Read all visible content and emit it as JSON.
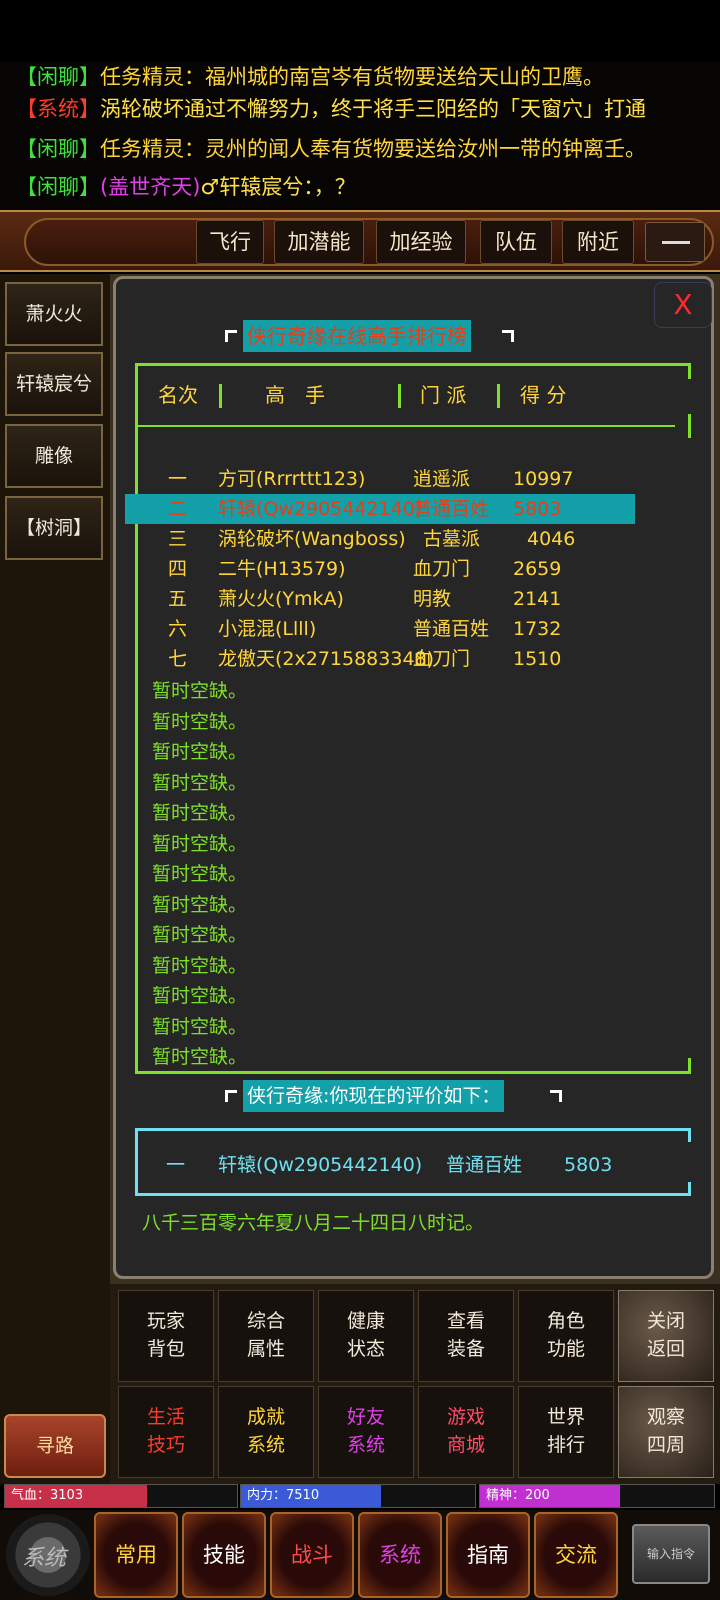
{
  "chat": [
    {
      "tag": "【闲聊】",
      "text": "任务精灵：福州城的南宫岑有货物要送给天山的卫鹰。",
      "kind": "chat"
    },
    {
      "tag": "【系统】",
      "text": "涡轮破坏通过不懈努力，终于将手三阳经的「天窗穴」打通",
      "kind": "sys"
    },
    {
      "tag": "【闲聊】",
      "text": "任务精灵：灵州的闻人奉有货物要送给汝州一带的钟离壬。",
      "kind": "chat"
    },
    {
      "tag": "【闲聊】",
      "nick": "(盖世齐天)",
      "gender": "♂",
      "text": "轩辕宸兮：，？",
      "kind": "chat"
    }
  ],
  "funcbar": {
    "buttons": [
      "飞行",
      "加潜能",
      "加经验",
      "队伍",
      "附近"
    ],
    "minimize_icon": "minus-icon"
  },
  "sidebar": {
    "items": [
      "萧火火",
      "轩辕宸兮",
      "雕像",
      "【树洞】"
    ],
    "route": "寻路"
  },
  "panel": {
    "close": "X",
    "title": "侠行奇缘在线高手排行榜",
    "header": {
      "rank": "名次",
      "name": "高　手",
      "sect": "门 派",
      "score": "得 分"
    },
    "rows": [
      {
        "rank": "一",
        "name": "方可(Rrrrttt123)",
        "sect": "逍遥派",
        "score": "10997"
      },
      {
        "rank": "二",
        "name": "轩辕(Qw2905442140)",
        "sect": "普通百姓",
        "score": "5803"
      },
      {
        "rank": "三",
        "name": "涡轮破坏(Wangboss)",
        "sect": "古墓派",
        "score": "4046"
      },
      {
        "rank": "四",
        "name": "二牛(H13579)",
        "sect": "血刀门",
        "score": "2659"
      },
      {
        "rank": "五",
        "name": "萧火火(YmkA)",
        "sect": "明教",
        "score": "2141"
      },
      {
        "rank": "六",
        "name": "小混混(Llll)",
        "sect": "普通百姓",
        "score": "1732"
      },
      {
        "rank": "七",
        "name": "龙傲天(2x2715883348)",
        "sect": "血刀门",
        "score": "1510"
      }
    ],
    "empty_text": "暂时空缺。",
    "empty_count": 13,
    "eval_title": "侠行奇缘:你现在的评价如下：",
    "eval_row": {
      "rank": "一",
      "name": "轩辕(Qw2905442140)",
      "sect": "普通百姓",
      "score": "5803"
    },
    "date": "八千三百零六年夏八月二十四日八时记。"
  },
  "menu": [
    {
      "l1": "玩家",
      "l2": "背包",
      "color": "white"
    },
    {
      "l1": "综合",
      "l2": "属性",
      "color": "white"
    },
    {
      "l1": "健康",
      "l2": "状态",
      "color": "white"
    },
    {
      "l1": "查看",
      "l2": "装备",
      "color": "white"
    },
    {
      "l1": "角色",
      "l2": "功能",
      "color": "white"
    },
    {
      "l1": "关闭",
      "l2": "返回",
      "color": "stone"
    },
    {
      "l1": "生活",
      "l2": "技巧",
      "color": "red"
    },
    {
      "l1": "成就",
      "l2": "系统",
      "color": "yellow"
    },
    {
      "l1": "好友",
      "l2": "系统",
      "color": "pink"
    },
    {
      "l1": "游戏",
      "l2": "商城",
      "color": "rose"
    },
    {
      "l1": "世界",
      "l2": "排行",
      "color": "white"
    },
    {
      "l1": "观察",
      "l2": "四周",
      "color": "stone"
    }
  ],
  "stats": [
    {
      "label": "气血：3103",
      "fill": 0.61,
      "color": "#c8304a"
    },
    {
      "label": "内力：7510",
      "fill": 0.6,
      "color": "#3a5ad8"
    },
    {
      "label": "精神：200",
      "fill": 0.6,
      "color": "#c030d0"
    }
  ],
  "bottom": {
    "system": "系统",
    "tabs": [
      {
        "label": "常用",
        "color": "#ffd53a"
      },
      {
        "label": "技能",
        "color": "#ffffff"
      },
      {
        "label": "战斗",
        "color": "#ff4a4a"
      },
      {
        "label": "系统",
        "color": "#e040e8"
      },
      {
        "label": "指南",
        "color": "#ffffff"
      },
      {
        "label": "交流",
        "color": "#ffd53a"
      }
    ],
    "command": "输入指令"
  }
}
